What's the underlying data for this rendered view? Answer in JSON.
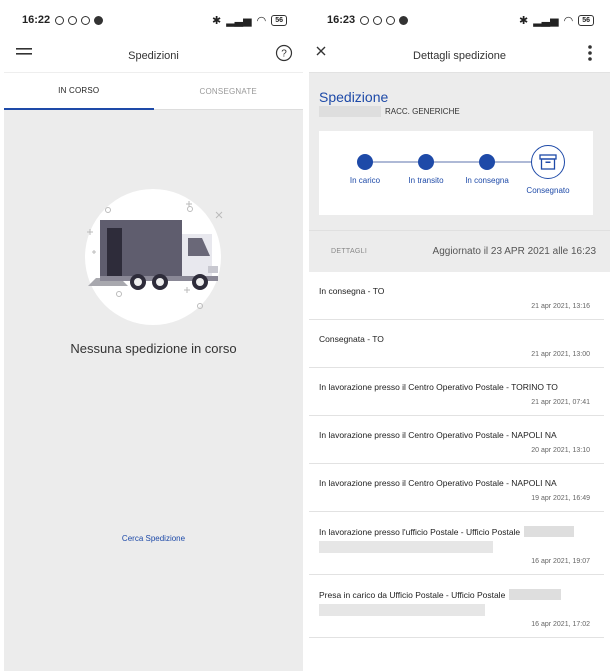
{
  "left": {
    "status": {
      "time": "16:22",
      "battery": "56"
    },
    "appbar": {
      "title": "Spedizioni"
    },
    "tabs": [
      {
        "label": "IN CORSO"
      },
      {
        "label": "CONSEGNATE"
      }
    ],
    "empty_message": "Nessuna spedizione in corso",
    "search_link": "Cerca Spedizione"
  },
  "right": {
    "status": {
      "time": "16:23",
      "battery": "56"
    },
    "appbar": {
      "title": "Dettagli spedizione"
    },
    "shipment": {
      "title": "Spedizione",
      "type": "RACC. GENERICHE"
    },
    "progress": [
      {
        "label": "In carico"
      },
      {
        "label": "In transito"
      },
      {
        "label": "In consegna"
      },
      {
        "label": "Consegnato"
      }
    ],
    "details": {
      "label": "DETTAGLI",
      "updated": "Aggiornato il 23 APR 2021 alle 16:23"
    },
    "events": [
      {
        "title": "In consegna -  TO",
        "date": "21 apr 2021, 13:16"
      },
      {
        "title": "Consegnata -  TO",
        "date": "21 apr 2021, 13:00"
      },
      {
        "title": "In lavorazione presso il Centro Operativo Postale - TORINO TO",
        "date": "21 apr 2021, 07:41"
      },
      {
        "title": "In lavorazione presso il Centro Operativo Postale - NAPOLI NA",
        "date": "20 apr 2021, 13:10"
      },
      {
        "title": "In lavorazione presso il Centro Operativo Postale - NAPOLI NA",
        "date": "19 apr 2021, 16:49"
      },
      {
        "title": "In lavorazione presso l'ufficio Postale - Ufficio Postale",
        "date": "16 apr 2021, 19:07"
      },
      {
        "title": "Presa in carico da Ufficio Postale - Ufficio Postale",
        "date": "16 apr 2021, 17:02"
      }
    ]
  },
  "colors": {
    "accent": "#1e4aa8",
    "background_grey": "#ececec"
  }
}
